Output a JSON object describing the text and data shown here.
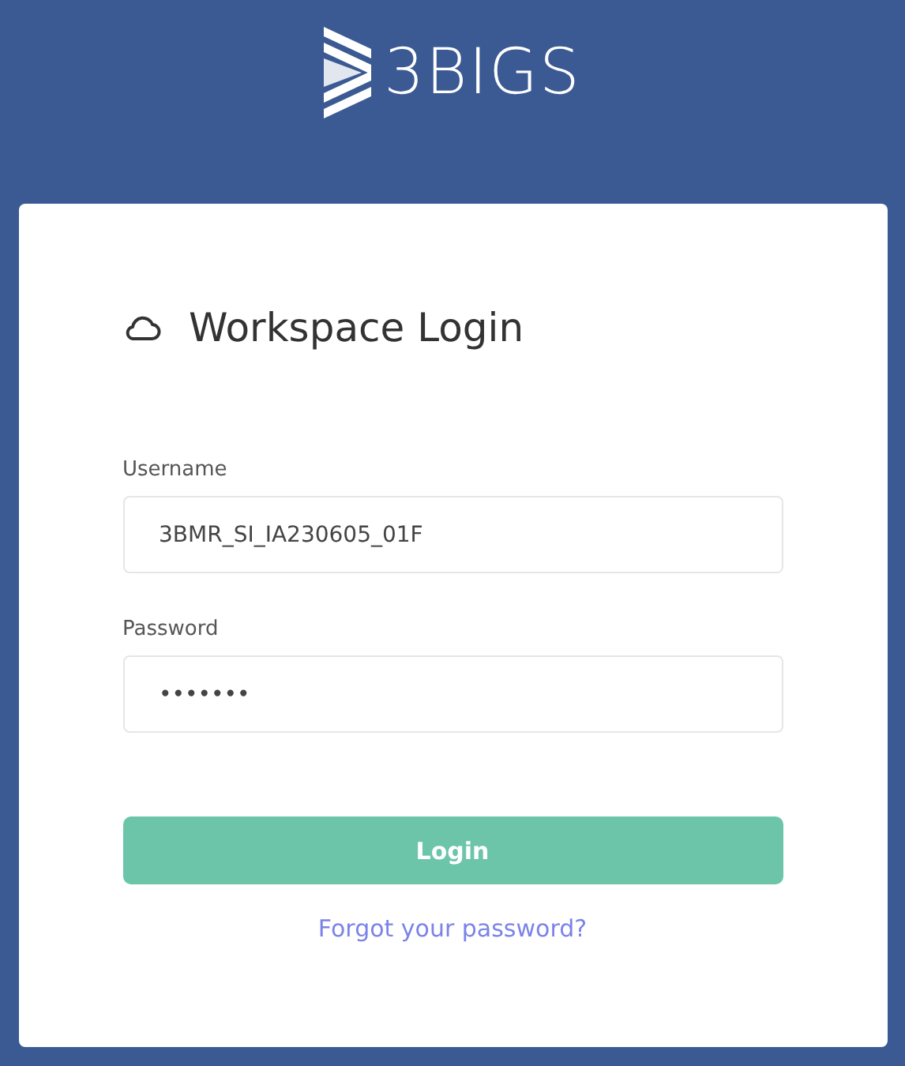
{
  "logo": {
    "text": "3BIGS"
  },
  "title": "Workspace Login",
  "fields": [
    {
      "label": "Username",
      "value": "3BMR_SI_IA230605_01F"
    },
    {
      "label": "Password",
      "value": "•••••••"
    }
  ],
  "login_button": {
    "label": "Login"
  },
  "forgot_link": "Forgot your password?"
}
